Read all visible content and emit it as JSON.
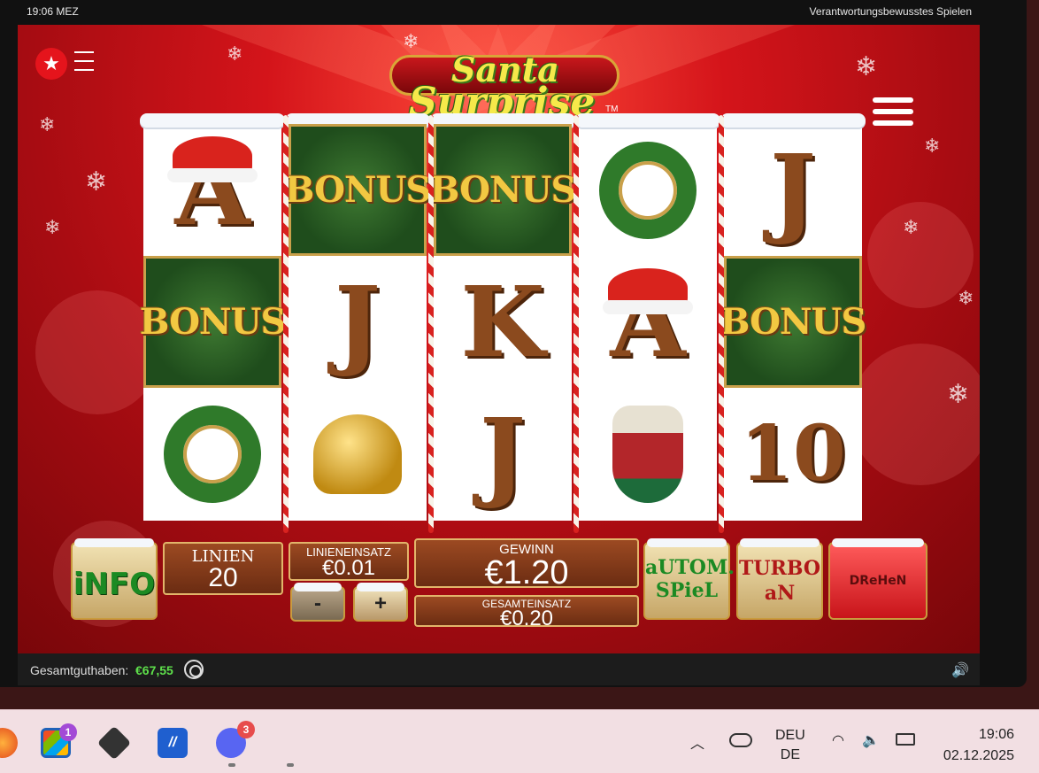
{
  "topbar": {
    "time": "19:06 MEZ",
    "responsible_gaming_link": "Verantwortungsbewusstes Spielen"
  },
  "game": {
    "title_line1": "Santa",
    "title_line2": "Surprise",
    "trademark": "TM",
    "reels": [
      [
        "A",
        "BONUS",
        "Q"
      ],
      [
        "BONUS",
        "J",
        "bell"
      ],
      [
        "BONUS",
        "K",
        "J"
      ],
      [
        "Q",
        "A",
        "stocking"
      ],
      [
        "J",
        "BONUS",
        "10"
      ]
    ]
  },
  "controls": {
    "info_label": "iNFO",
    "lines_label": "LINIEN",
    "lines_value": "20",
    "line_bet_label": "LINIENEINSATZ",
    "line_bet_value": "€0.01",
    "minus_label": "-",
    "plus_label": "+",
    "win_label": "GEWINN",
    "win_value": "€1.20",
    "total_bet_label": "GESAMTEINSATZ",
    "total_bet_value": "€0.20",
    "autoplay_line1": "aUTOM.",
    "autoplay_line2": "SPieL",
    "turbo_line1": "TURBO",
    "turbo_line2": "aN",
    "spin_label": "DReHeN"
  },
  "balance": {
    "label": "Gesamtguthaben:",
    "value": "€67,55"
  },
  "taskbar": {
    "store_badge": "1",
    "discord_badge": "3",
    "lang_line1": "DEU",
    "lang_line2": "DE",
    "clock_time": "19:06",
    "clock_date": "02.12.2025"
  }
}
